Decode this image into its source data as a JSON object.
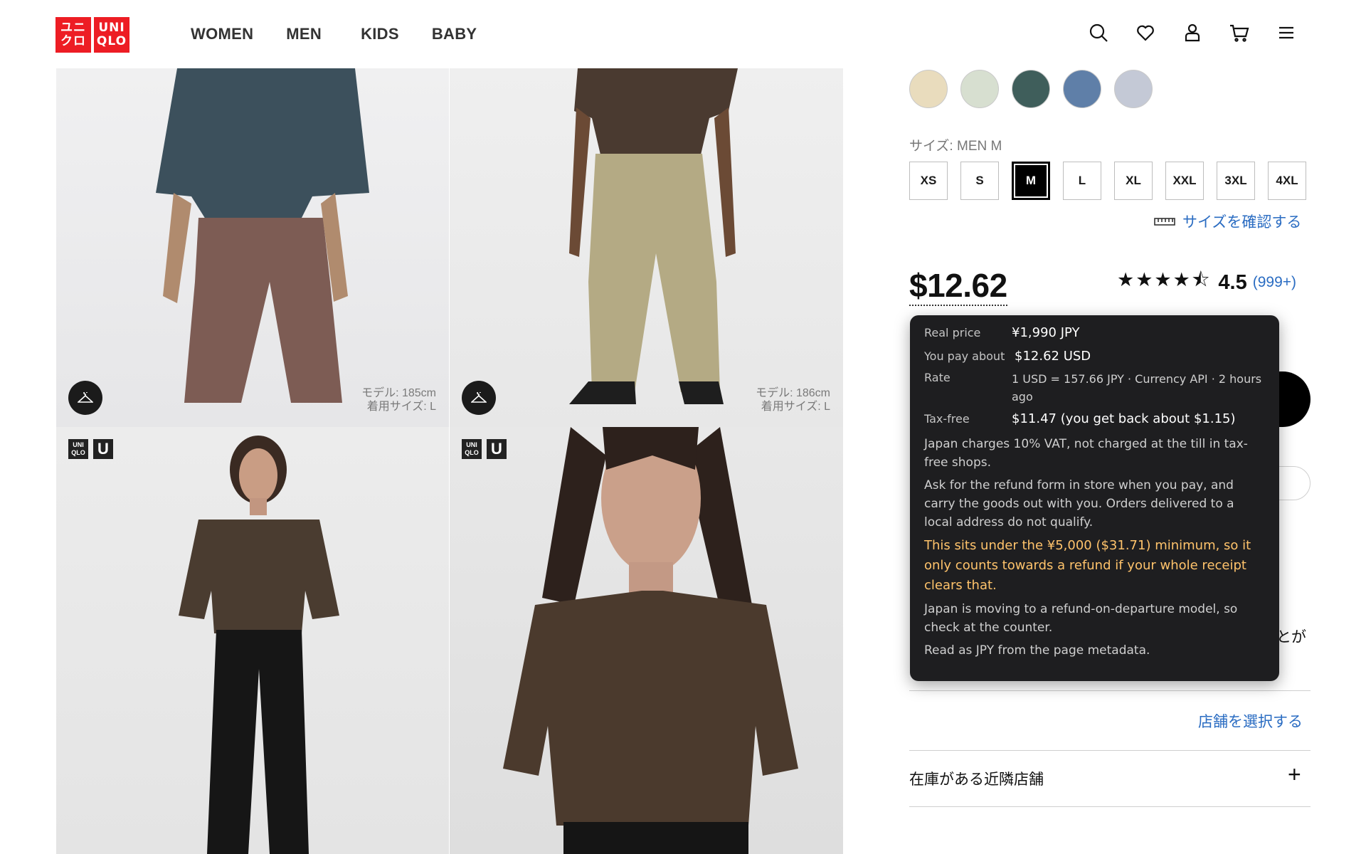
{
  "brand": {
    "logo_top": [
      "ユニ",
      "クロ"
    ],
    "logo_bottom": [
      "UNI",
      "QLO"
    ],
    "accent": "#ed1d24"
  },
  "nav": {
    "items": [
      "WOMEN",
      "MEN",
      "KIDS",
      "BABY"
    ]
  },
  "header_icons": [
    "search-icon",
    "heart-icon",
    "account-icon",
    "cart-icon",
    "menu-icon"
  ],
  "gallery": {
    "tiles": [
      {
        "model_note_1": "モデル: 185cm",
        "model_note_2": "着用サイズ: L"
      },
      {
        "model_note_1": "モデル: 186cm",
        "model_note_2": "着用サイズ: L"
      },
      {
        "badge_uq": [
          "UNI",
          "QLO"
        ],
        "badge_u": "U"
      },
      {
        "badge_uq": [
          "UNI",
          "QLO"
        ],
        "badge_u": "U"
      }
    ]
  },
  "product": {
    "colors": [
      "#e9dcbd",
      "#d7dfd0",
      "#3f5e5b",
      "#5f7fa8",
      "#c4c9d6"
    ],
    "size_label": "サイズ: MEN M",
    "sizes": [
      "XS",
      "S",
      "M",
      "L",
      "XL",
      "XXL",
      "3XL",
      "4XL"
    ],
    "selected_size": "M",
    "size_check_link": "サイズを確認する",
    "price": "$12.62",
    "rating": {
      "stars": "★★★★⯪",
      "score": "4.5",
      "count": "(999+)"
    },
    "partial_text": "とが",
    "store_link": "店舗を選択する",
    "nearby_stores": "在庫がある近隣店舗",
    "expand_icon": "+"
  },
  "tooltip": {
    "real_price_label": "Real price",
    "real_price_value": "¥1,990 JPY",
    "pay_about_label": "You pay about",
    "pay_about_value": "$12.62 USD",
    "rate_label": "Rate",
    "rate_value": "1 USD = 157.66 JPY · Currency API · 2 hours ago",
    "taxfree_label": "Tax-free",
    "taxfree_value": "$11.47 (you get back about $1.15)",
    "vat_note": "Japan charges 10% VAT, not charged at the till in tax-free shops.",
    "refund_note": "Ask for the refund form in store when you pay, and carry the goods out with you. Orders delivered to a local address do not qualify.",
    "warning": "This sits under the ¥5,000 ($31.71) minimum, so it only counts towards a refund if your whole receipt clears that.",
    "departure_note": "Japan is moving to a refund-on-departure model, so check at the counter.",
    "source_note": "Read as JPY from the page metadata.",
    "warning_color": "#ffc36b"
  }
}
